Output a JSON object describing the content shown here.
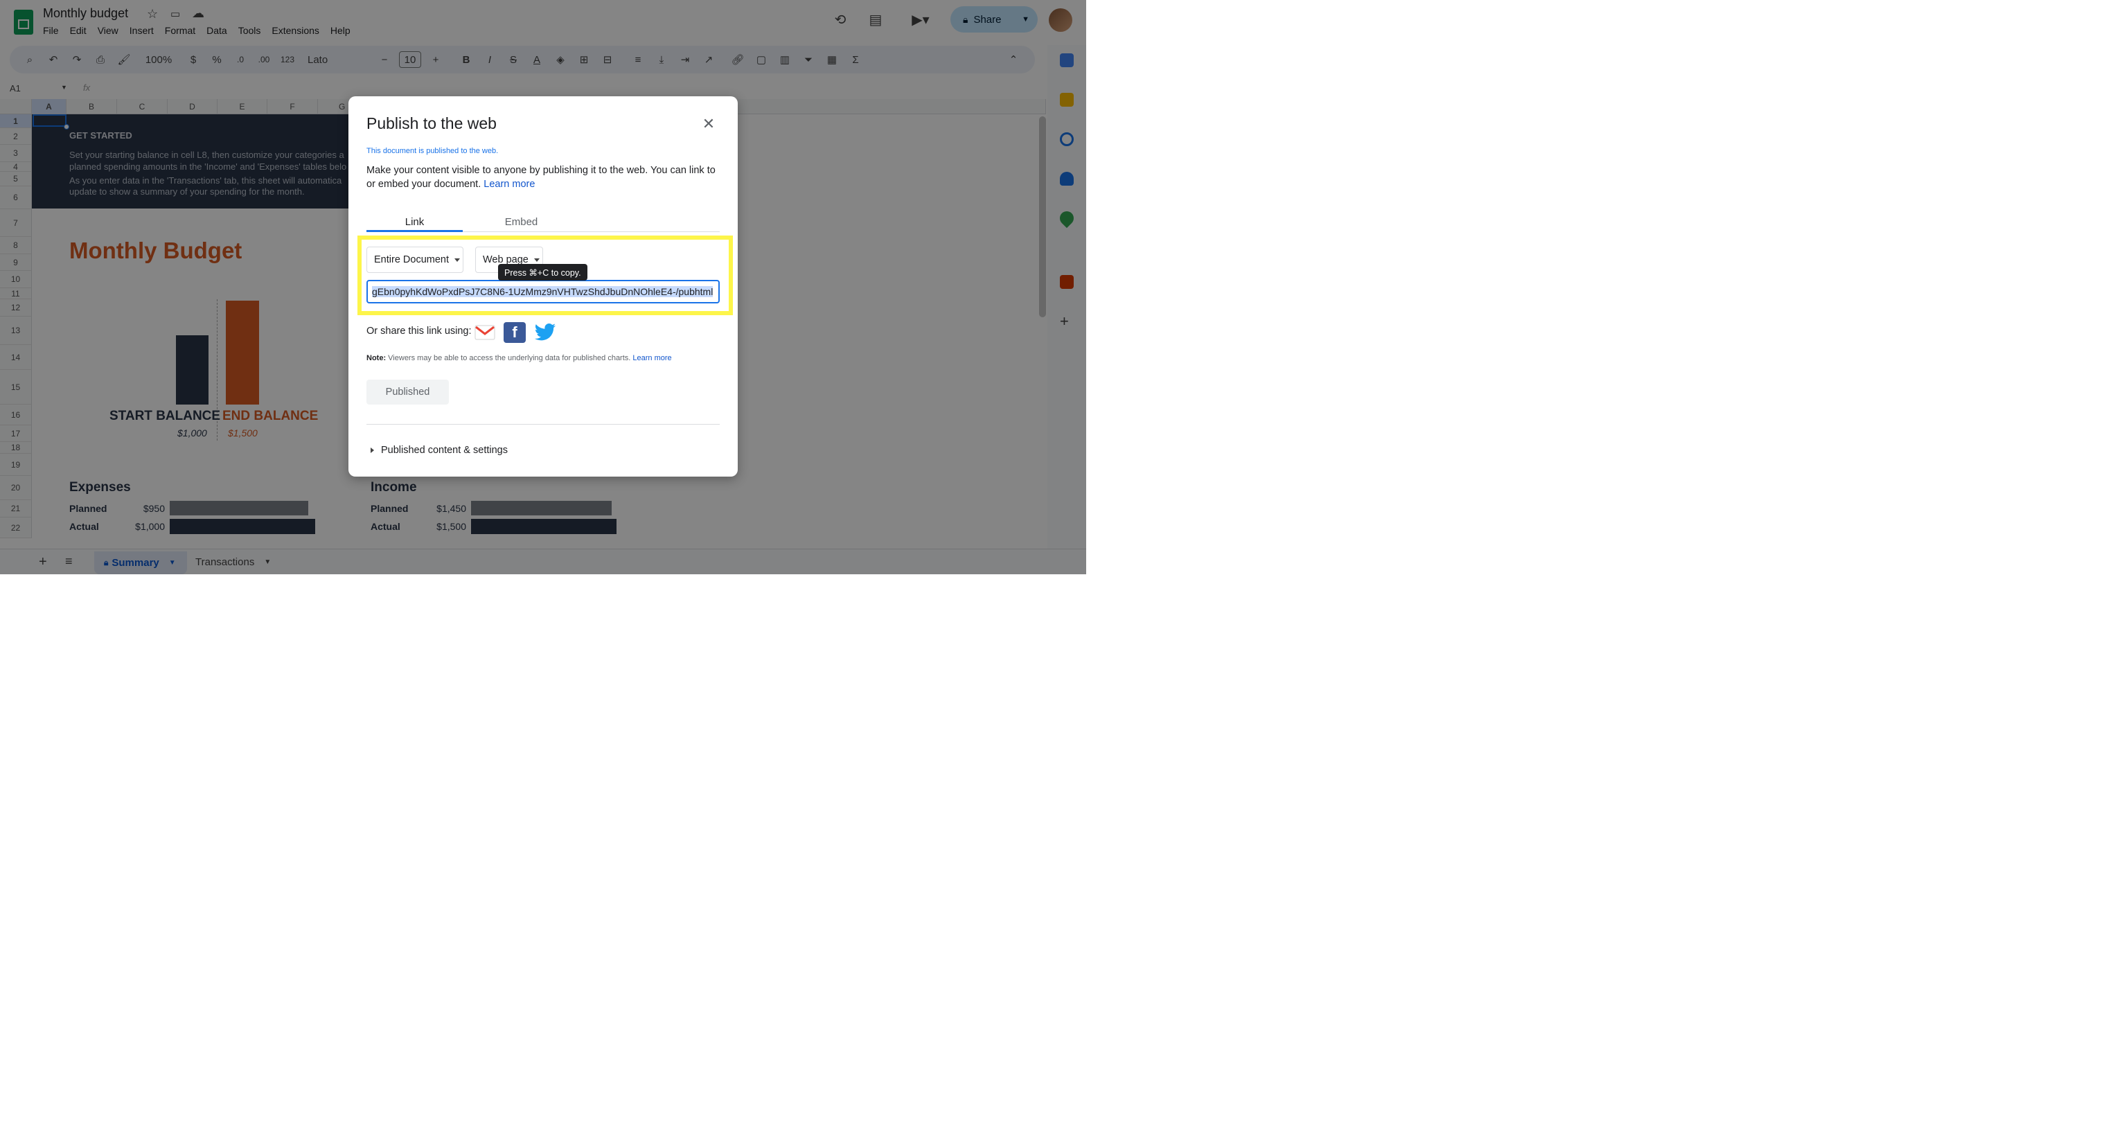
{
  "app": {
    "doc_title": "Monthly budget",
    "menu": [
      "File",
      "Edit",
      "View",
      "Insert",
      "Format",
      "Data",
      "Tools",
      "Extensions",
      "Help"
    ],
    "share_label": "Share"
  },
  "toolbar": {
    "zoom": "100%",
    "currency": "$",
    "percent": "%",
    "dec_less": ".0",
    "dec_more": ".00",
    "number_format": "123",
    "font": "Lato",
    "font_size": "10",
    "bold": "B",
    "italic": "I",
    "text_color": "A"
  },
  "formula_bar": {
    "cell_ref": "A1",
    "fx": "fx"
  },
  "grid": {
    "columns": [
      "A",
      "B",
      "C",
      "D",
      "E",
      "F",
      "G"
    ],
    "rows": [
      "1",
      "2",
      "3",
      "4",
      "5",
      "6",
      "7",
      "8",
      "9",
      "10",
      "11",
      "12",
      "13",
      "14",
      "15",
      "16",
      "17",
      "18",
      "19",
      "20",
      "21",
      "22"
    ]
  },
  "sheet": {
    "get_started": "GET STARTED",
    "line1": "Set your starting balance in cell L8, then customize your categories a",
    "line2": "planned spending amounts in the 'Income' and 'Expenses' tables belo",
    "line3": "As you enter data in the 'Transactions' tab, this sheet will automatica",
    "line4": "update to show a summary of your spending for the month.",
    "title": "Monthly Budget",
    "start_label": "START BALANCE",
    "end_label": "END BALANCE",
    "start_amount": "$1,000",
    "end_amount": "$1,500",
    "expenses_title": "Expenses",
    "income_title": "Income",
    "planned": "Planned",
    "actual": "Actual",
    "exp_planned": "$950",
    "exp_actual": "$1,000",
    "inc_planned": "$1,450",
    "inc_actual": "$1,500"
  },
  "chart_data": {
    "type": "bar",
    "categories": [
      "START BALANCE",
      "END BALANCE"
    ],
    "values": [
      1000,
      1500
    ]
  },
  "dialog": {
    "title": "Publish to the web",
    "published_notice": "This document is published to the web.",
    "description": "Make your content visible to anyone by publishing it to the web. You can link to or embed your document.",
    "learn_more": "Learn more",
    "tabs": [
      "Link",
      "Embed"
    ],
    "scope_select": "Entire Document",
    "format_select": "Web page",
    "tooltip": "Press ⌘+C to copy.",
    "url_visible": "gEbn0pyhKdWoPxdPsJ7C8N6-1UzMmz9nVHTwzShdJbuDnNOhleE4-/pubhtml",
    "share_using": "Or share this link using:",
    "note_label": "Note:",
    "note_text": "Viewers may be able to access the underlying data for published charts.",
    "note_link": "Learn more",
    "published_button": "Published",
    "settings_toggle": "Published content & settings"
  },
  "bottom": {
    "add": "+",
    "tabs": [
      "Summary",
      "Transactions"
    ]
  },
  "colors": {
    "accent": "#1a73e8",
    "highlight": "#fdf54a",
    "navy": "#293447",
    "orange": "#d65a24"
  }
}
